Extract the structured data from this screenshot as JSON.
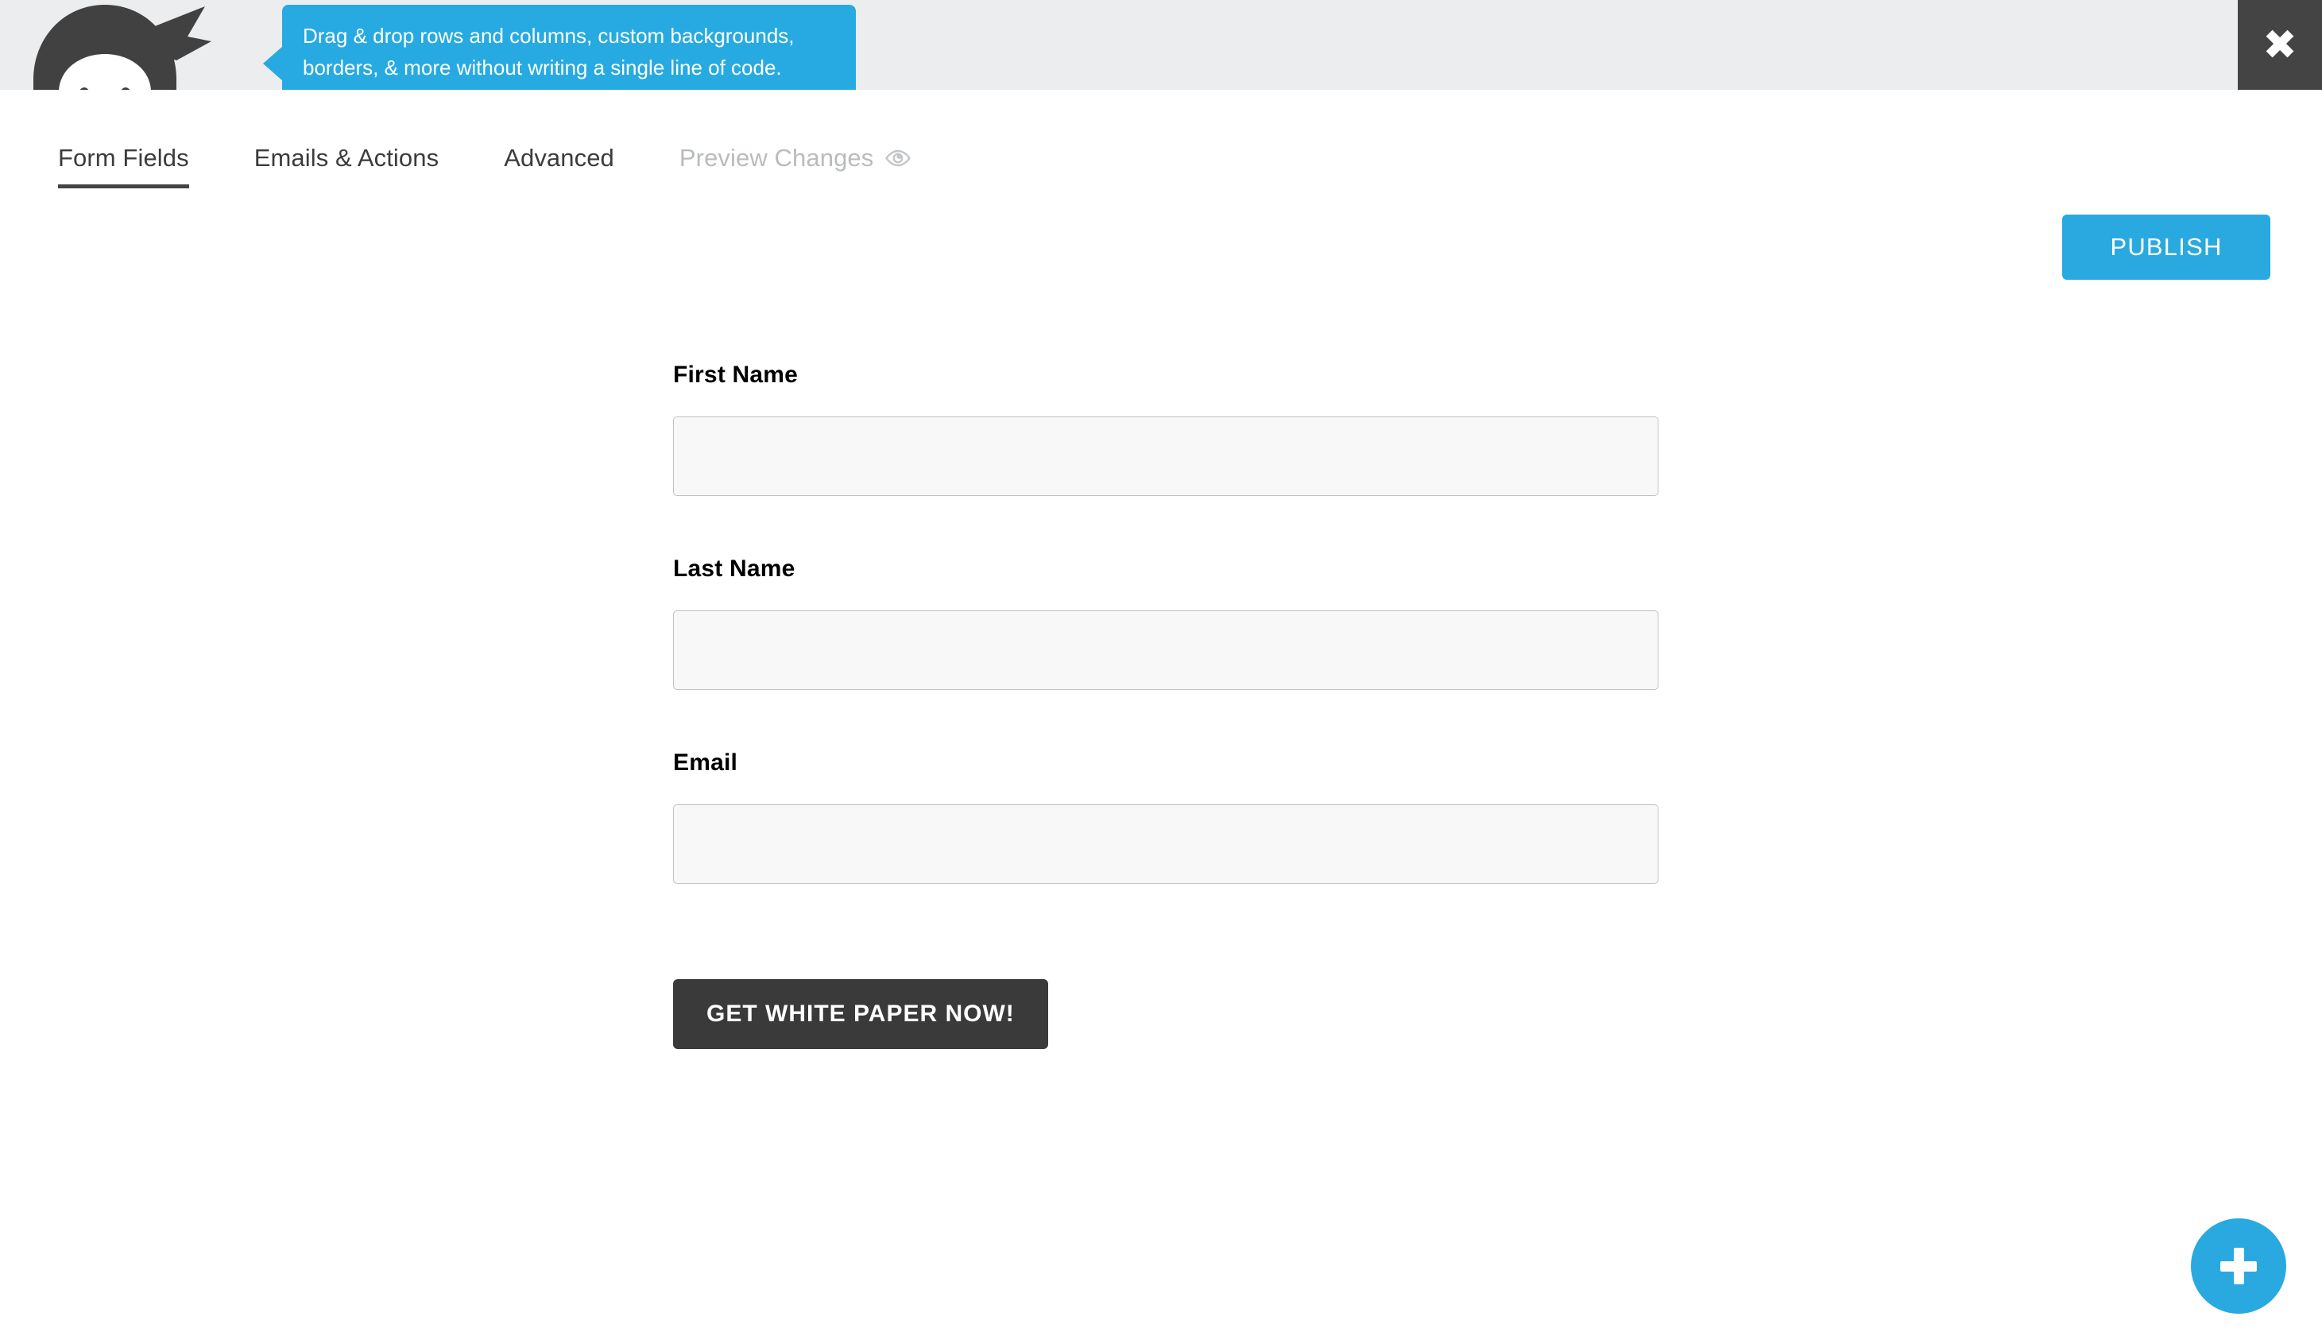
{
  "header": {
    "tooltip_text": "Drag & drop rows and columns, custom backgrounds, borders, & more without writing a single line of code.",
    "mascot_icon": "ninja-mascot-icon",
    "close_icon": "close-icon",
    "close_glyph": "✖",
    "band_color": "#ebedee",
    "tooltip_color": "#27aae1",
    "close_bg_color": "#444444"
  },
  "nav": {
    "tabs": [
      {
        "label": "Form Fields",
        "active": true,
        "muted": false
      },
      {
        "label": "Emails & Actions",
        "active": false,
        "muted": false
      },
      {
        "label": "Advanced",
        "active": false,
        "muted": false
      },
      {
        "label": "Preview Changes",
        "active": false,
        "muted": true,
        "icon": "eye-icon"
      }
    ],
    "publish_label": "PUBLISH",
    "publish_color": "#29a9e0"
  },
  "form": {
    "fields": [
      {
        "label": "First Name",
        "value": "",
        "placeholder": "",
        "type": "text"
      },
      {
        "label": "Last Name",
        "value": "",
        "placeholder": "",
        "type": "text"
      },
      {
        "label": "Email",
        "value": "",
        "placeholder": "",
        "type": "email"
      }
    ],
    "submit_label": "GET WHITE PAPER NOW!",
    "submit_color": "#3a3a3a",
    "input_bg": "#f8f8f8",
    "input_border": "#c2c2c2"
  },
  "fab": {
    "icon": "plus-icon",
    "color": "#29a9e0"
  }
}
